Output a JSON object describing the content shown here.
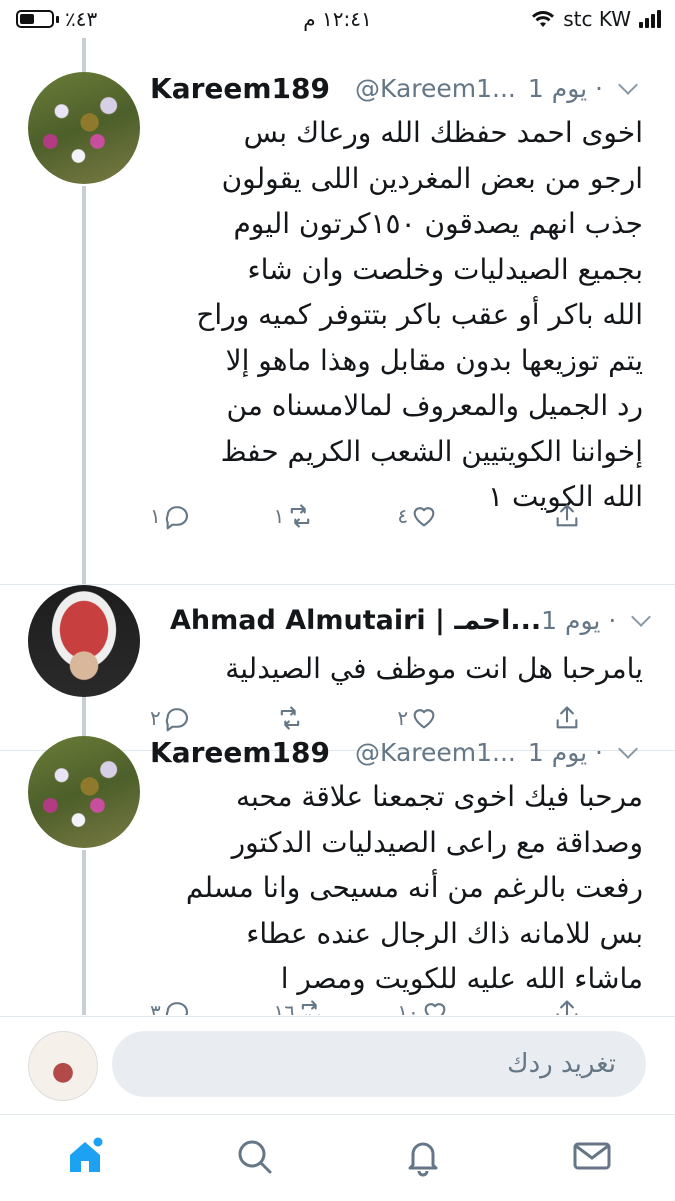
{
  "status_bar": {
    "battery": "٪٤٣",
    "time": "١٢:٤١ م",
    "carrier": "stc KW"
  },
  "tweets": [
    {
      "name": "Kareem189",
      "handle": "@Kareem1...",
      "time": "1 يوم ·",
      "avatar_icon": "flowers-avatar",
      "lines": [
        "اخوى احمد حفظك الله ورعاك بس",
        "ارجو من بعض المغردين اللى يقولون",
        "جذب انهم يصدقون ١٥٠كرتون اليوم",
        "بجميع الصيدليات وخلصت وان شاء",
        "الله باكر أو عقب باكر بتتوفر كميه وراح",
        "يتم توزيعها بدون مقابل وهذا ماهو إلا",
        "رد الجميل والمعروف لمالامسناه من",
        "إخواننا الكويتيين الشعب الكريم حفظ",
        "الله الكويت ١"
      ],
      "replies": "١",
      "retweets": "١",
      "likes": "٤"
    },
    {
      "name": "Ahmad Almutairi | احمـ...",
      "handle": "",
      "time": "1 يوم ·",
      "avatar_icon": "person-avatar",
      "lines": [
        "يامرحبا هل انت موظف في الصيدلية"
      ],
      "replies": "٢",
      "retweets": "",
      "likes": "٢"
    },
    {
      "name": "Kareem189",
      "handle": "@Kareem1...",
      "time": "1 يوم ·",
      "avatar_icon": "flowers-avatar",
      "lines": [
        "مرحبا فيك اخوى تجمعنا علاقة محبه",
        "وصداقة مع راعى الصيدليات الدكتور",
        "رفعت بالرغم من أنه مسيحى وانا مسلم",
        "بس للامانه ذاك الرجال عنده عطاء",
        "ماشاء الله عليه للكويت ومصر ا"
      ],
      "replies": "٣",
      "retweets": "١٦",
      "likes": "١٠"
    }
  ],
  "reply_bar": {
    "placeholder": "تغريد ردك"
  },
  "tabbar": {
    "items": [
      "home-icon",
      "search-icon",
      "notifications-icon",
      "messages-icon"
    ]
  },
  "colors": {
    "accent": "#1da1f2",
    "muted": "#657786",
    "thread": "#c4cfd6"
  }
}
